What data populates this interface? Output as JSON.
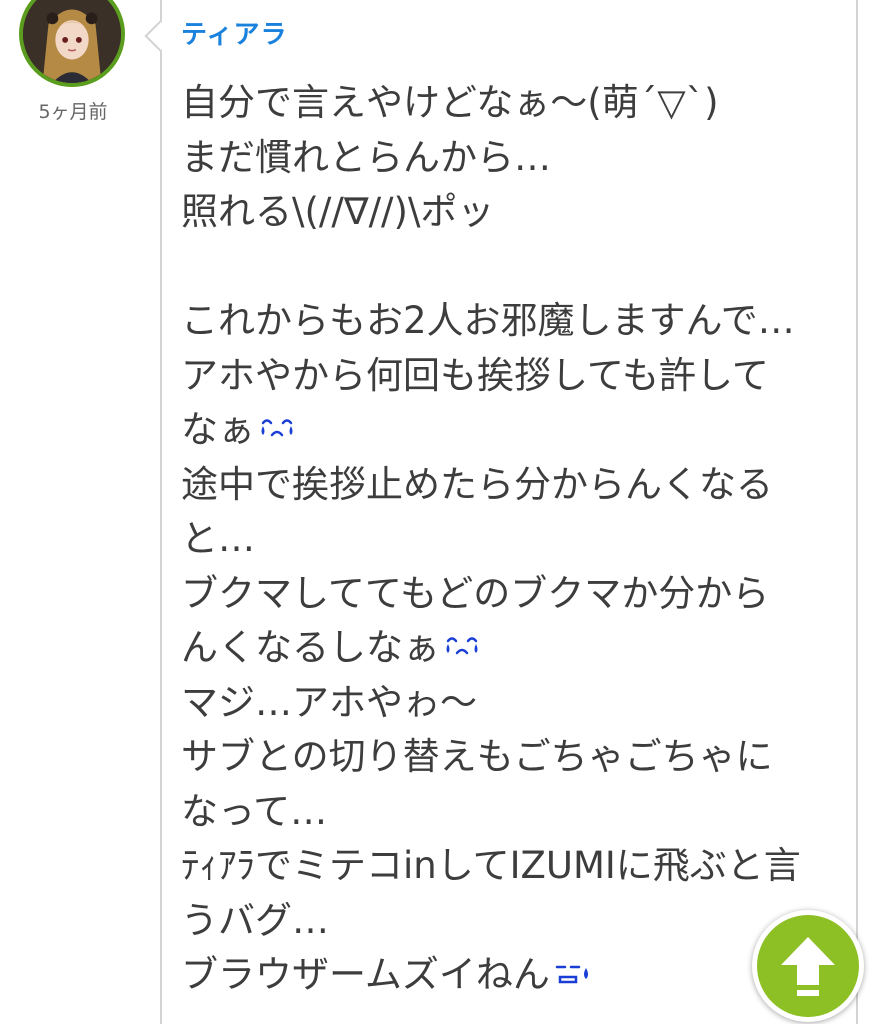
{
  "comment": {
    "username": "ティアラ",
    "timestamp": "5ヶ月前",
    "lines": [
      {
        "text": "自分で言えやけどなぁ〜(萌´▽`)",
        "emoji": ""
      },
      {
        "text": "まだ慣れとらんから…",
        "emoji": ""
      },
      {
        "text": "照れる\\(//∇//)\\ポッ",
        "emoji": ""
      },
      {
        "text": "",
        "emoji": ""
      },
      {
        "text": "これからもお2人お邪魔しますんで…",
        "emoji": ""
      },
      {
        "text": "アホやから何回も挨拶しても許して",
        "emoji": ""
      },
      {
        "text": "なぁ",
        "emoji": "crying-face-icon"
      },
      {
        "text": "途中で挨拶止めたら分からんくなる",
        "emoji": ""
      },
      {
        "text": "と…",
        "emoji": ""
      },
      {
        "text": "ブクマしててもどのブクマか分から",
        "emoji": ""
      },
      {
        "text": "んくなるしなぁ",
        "emoji": "crying-face-icon"
      },
      {
        "text": "マジ…アホやゎ〜",
        "emoji": ""
      },
      {
        "text": "サブとの切り替えもごちゃごちゃに",
        "emoji": ""
      },
      {
        "text": "なって…",
        "emoji": ""
      },
      {
        "text": "ﾃｨｱﾗでミテコinしてIZUMIに飛ぶと言",
        "emoji": ""
      },
      {
        "text": "うバグ…",
        "emoji": ""
      },
      {
        "text": "ブラウザームズイねん",
        "emoji": "sweat-drop-face-icon"
      }
    ]
  },
  "scroll_top_button": {
    "icon": "arrow-up-icon"
  },
  "colors": {
    "username": "#1a82dc",
    "text": "#3d3d3d",
    "timestamp": "#666666",
    "avatar_ring": "#5b9e1f",
    "scroll_button": "#8cc025",
    "emoji": "#1a3fd6"
  }
}
